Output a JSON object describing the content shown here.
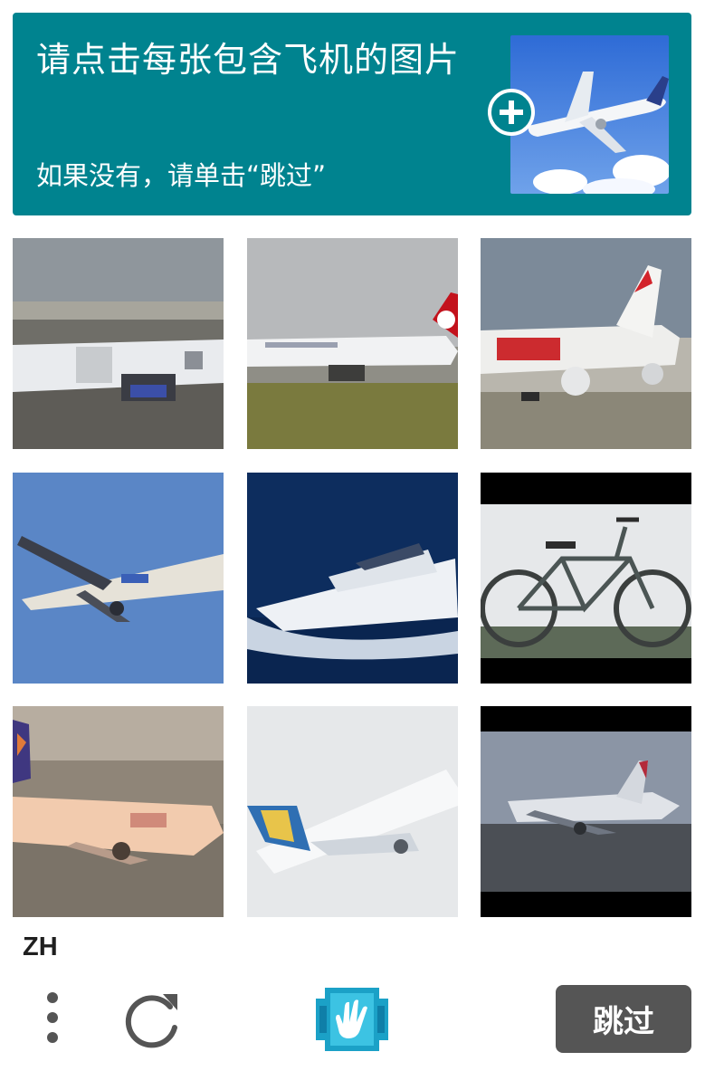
{
  "header": {
    "title": "请点击每张包含飞机的图片",
    "subtitle": "如果没有，请单击“跳过”",
    "background_color": "#00838f",
    "example_image": "airplane-example",
    "add_icon": "plus-icon"
  },
  "grid": {
    "tiles": [
      {
        "content": "airplane-on-tarmac-closeup"
      },
      {
        "content": "airplane-taxiing-on-grass"
      },
      {
        "content": "airplane-red-tail-on-runway"
      },
      {
        "content": "airplane-flying-blue-sky"
      },
      {
        "content": "white-yacht-on-sea"
      },
      {
        "content": "bicycle"
      },
      {
        "content": "airplane-landing-orange-livery"
      },
      {
        "content": "airplane-takeoff-blue-tail"
      },
      {
        "content": "jumbo-jet-takeoff-dark"
      }
    ]
  },
  "footer": {
    "language": "ZH",
    "menu_icon": "vertical-dots-icon",
    "refresh_icon": "refresh-icon",
    "logo_icon": "hcaptcha-hand-logo",
    "skip_label": "跳过",
    "skip_color": "#555555"
  }
}
